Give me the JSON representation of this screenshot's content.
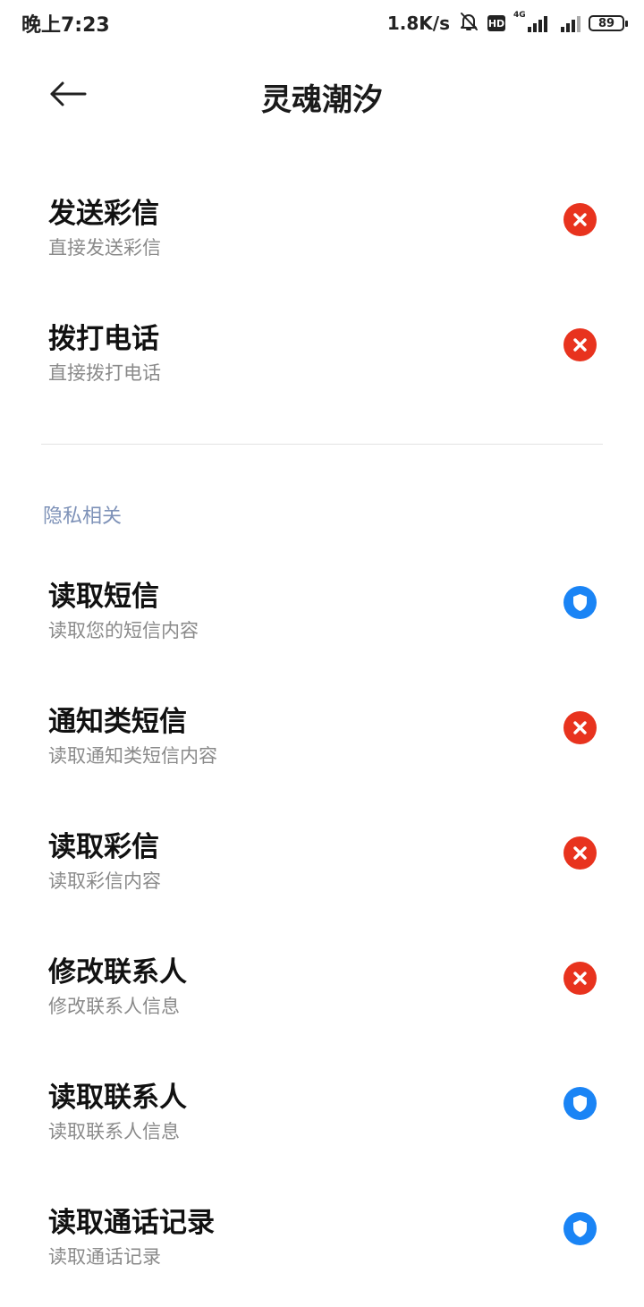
{
  "status_bar": {
    "time": "晚上7:23",
    "net_speed": "1.8K/s",
    "hd": "HD",
    "network_gen": "4G",
    "battery": "89",
    "icons": [
      "mute-bell-icon",
      "signal-icon",
      "battery-icon"
    ]
  },
  "header": {
    "title": "灵魂潮汐",
    "back_icon": "arrow-left-icon"
  },
  "colors": {
    "deny": "#e8331e",
    "protect": "#1a84f5",
    "section_title": "#7e92b8"
  },
  "top_items": [
    {
      "title": "发送彩信",
      "subtitle": "直接发送彩信",
      "status": "deny"
    },
    {
      "title": "拨打电话",
      "subtitle": "直接拨打电话",
      "status": "deny"
    }
  ],
  "privacy_section": {
    "title": "隐私相关",
    "items": [
      {
        "title": "读取短信",
        "subtitle": "读取您的短信内容",
        "status": "protect"
      },
      {
        "title": "通知类短信",
        "subtitle": "读取通知类短信内容",
        "status": "deny"
      },
      {
        "title": "读取彩信",
        "subtitle": "读取彩信内容",
        "status": "deny"
      },
      {
        "title": "修改联系人",
        "subtitle": "修改联系人信息",
        "status": "deny"
      },
      {
        "title": "读取联系人",
        "subtitle": "读取联系人信息",
        "status": "protect"
      },
      {
        "title": "读取通话记录",
        "subtitle": "读取通话记录",
        "status": "protect"
      }
    ]
  }
}
